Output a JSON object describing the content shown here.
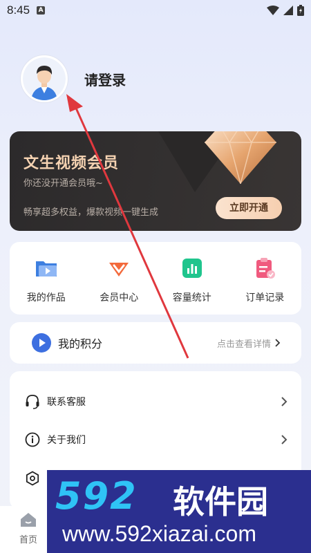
{
  "status_bar": {
    "time": "8:45",
    "notification_icon": "A"
  },
  "profile": {
    "login_label": "请登录"
  },
  "vip": {
    "title": "文生视频会员",
    "subtitle": "你还没开通会员哦~",
    "description": "畅享超多权益，爆款视频一键生成",
    "open_button": "立即开通"
  },
  "quick_actions": [
    {
      "label": "我的作品",
      "icon": "folder-play-icon"
    },
    {
      "label": "会员中心",
      "icon": "vip-crown-icon"
    },
    {
      "label": "容量统计",
      "icon": "bar-chart-icon"
    },
    {
      "label": "订单记录",
      "icon": "clipboard-icon"
    }
  ],
  "points": {
    "label": "我的积分",
    "detail_link": "点击查看详情"
  },
  "menu": [
    {
      "label": "联系客服",
      "icon": "headset-icon"
    },
    {
      "label": "关于我们",
      "icon": "info-icon"
    },
    {
      "label": "",
      "icon": "settings-icon"
    }
  ],
  "bottom_nav": {
    "home_label": "首页"
  },
  "watermark": {
    "logo": "592",
    "name": "软件园",
    "url": "www.592xiazai.com"
  },
  "colors": {
    "accent_gold": "#f6d3b2",
    "vip_bg": "#2c2a2b",
    "watermark_bg": "#2b2f8f",
    "watermark_logo": "#2fc3f6"
  }
}
